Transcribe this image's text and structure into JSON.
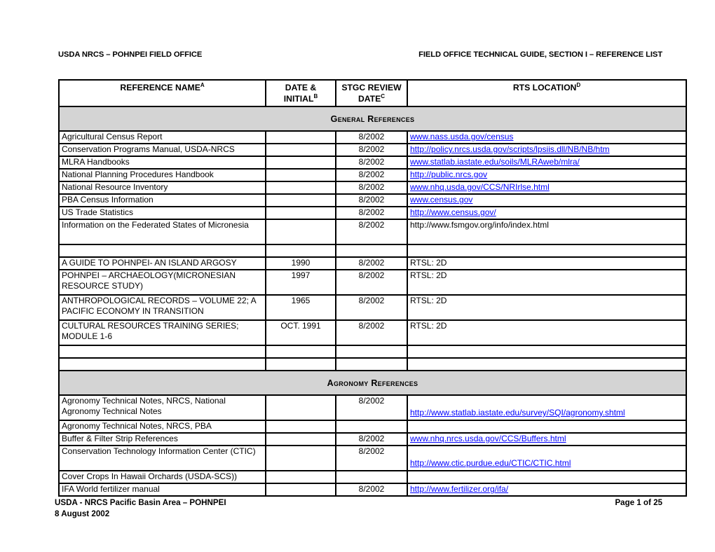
{
  "header": {
    "left": "USDA NRCS – POHNPEI FIELD OFFICE",
    "right": "FIELD OFFICE TECHNICAL GUIDE, SECTION I – REFERENCE LIST"
  },
  "table": {
    "columns": [
      {
        "label": "REFERENCE NAME",
        "sup": "A"
      },
      {
        "label": "DATE & INITIAL",
        "sup": "B"
      },
      {
        "label": "STGC REVIEW DATE",
        "sup": "C"
      },
      {
        "label": "RTS LOCATION",
        "sup": "D"
      }
    ],
    "column_labels": {
      "name": "REFERENCE NAME",
      "name_sup": "A",
      "date_l1": "DATE &",
      "date_l2": "INITIAL",
      "date_sup": "B",
      "stgc_l1": "STGC REVIEW",
      "stgc_l2": "DATE",
      "stgc_sup": "C",
      "rts": "RTS LOCATION",
      "rts_sup": "D"
    },
    "sections": [
      {
        "title": "General References",
        "rows": [
          {
            "name": "Agricultural Census Report",
            "date": "",
            "stgc": "8/2002",
            "rts": "www.nass.usda.gov/census",
            "link": true
          },
          {
            "name": "Conservation Programs Manual, USDA-NRCS",
            "date": "",
            "stgc": "8/2002",
            "rts": "http://policy.nrcs.usda.gov/scripts/lpsiis.dll/NB/NB/htm",
            "link": true
          },
          {
            "name": "MLRA Handbooks",
            "date": "",
            "stgc": "8/2002",
            "rts": "www.statlab.iastate.edu/soils/MLRAweb/mlra/",
            "link": true
          },
          {
            "name": "National Planning Procedures Handbook",
            "date": "",
            "stgc": "8/2002",
            "rts": "http://public.nrcs.gov",
            "link": true
          },
          {
            "name": "National Resource Inventory",
            "date": "",
            "stgc": "8/2002",
            "rts": "www.nhq.usda.gov/CCS/NRIrlse.html",
            "link": true
          },
          {
            "name": "PBA Census Information",
            "date": "",
            "stgc": "8/2002",
            "rts": "www.census.gov",
            "link": true
          },
          {
            "name": "US Trade Statistics",
            "date": "",
            "stgc": "8/2002",
            "rts": "http://www.census.gov/",
            "link": true
          },
          {
            "name": "Information on the Federated States of Micronesia",
            "date": "",
            "stgc": "8/2002",
            "rts": "http://www.fsmgov.org/info/index.html",
            "link": false,
            "tall": true
          },
          {
            "name": "",
            "date": "",
            "stgc": "",
            "rts": "",
            "link": false,
            "blank": true
          },
          {
            "name": "A GUIDE TO POHNPEI- AN ISLAND ARGOSY",
            "date": "1990",
            "stgc": "8/2002",
            "rts": "RTSL: 2D",
            "link": false
          },
          {
            "name": "POHNPEI – ARCHAEOLOGY(MICRONESIAN RESOURCE STUDY)",
            "date": "1997",
            "stgc": "8/2002",
            "rts": "RTSL: 2D",
            "link": false,
            "tall": true
          },
          {
            "name": "ANTHROPOLOGICAL RECORDS – VOLUME 22; A PACIFIC ECONOMY IN TRANSITION",
            "date": "1965",
            "stgc": "8/2002",
            "rts": "RTSL: 2D",
            "link": false,
            "tall": true
          },
          {
            "name": "CULTURAL RESOURCES TRAINING SERIES; MODULE 1-6",
            "date": "OCT. 1991",
            "stgc": "8/2002",
            "rts": "RTSL: 2D",
            "link": false,
            "tall": true
          },
          {
            "name": "",
            "date": "",
            "stgc": "",
            "rts": "",
            "link": false,
            "blank": true
          },
          {
            "name": "",
            "date": "",
            "stgc": "",
            "rts": "",
            "link": false,
            "blank": true
          }
        ]
      },
      {
        "title": "Agronomy References",
        "rows": [
          {
            "name": "Agronomy Technical Notes, NRCS, National Agronomy Technical Notes",
            "date": "",
            "stgc": "8/2002",
            "rts": "http://www.statlab.iastate.edu/survey/SQI/agronomy.shtml",
            "link": true,
            "tall": true,
            "rts_bottom": true
          },
          {
            "name": "Agronomy Technical Notes, NRCS, PBA",
            "date": "",
            "stgc": "",
            "rts": "",
            "link": false
          },
          {
            "name": "Buffer & Filter Strip References",
            "date": "",
            "stgc": "8/2002",
            "rts": "www.nhq.nrcs.usda.gov/CCS/Buffers.html",
            "link": true
          },
          {
            "name": "Conservation Technology Information Center (CTIC)",
            "date": "",
            "stgc": "8/2002",
            "rts": "http://www.ctic.purdue.edu/CTIC/CTIC.html",
            "link": true,
            "tall": true,
            "rts_bottom": true
          },
          {
            "name": "Cover Crops In Hawaii Orchards (USDA-SCS))",
            "date": "",
            "stgc": "",
            "rts": "",
            "link": false
          },
          {
            "name": "IFA World fertilizer manual",
            "date": "",
            "stgc": "8/2002",
            "rts": "http://www.fertilizer.org/ifa/",
            "link": true
          }
        ]
      }
    ]
  },
  "footer": {
    "left": "USDA - NRCS Pacific Basin Area – POHNPEI",
    "right": "Page 1 of 25",
    "date": "8 August 2002"
  },
  "colors": {
    "link": "#0000FF",
    "section_band": "#D4D4D4",
    "text": "#000000",
    "background": "#FFFFFF"
  }
}
